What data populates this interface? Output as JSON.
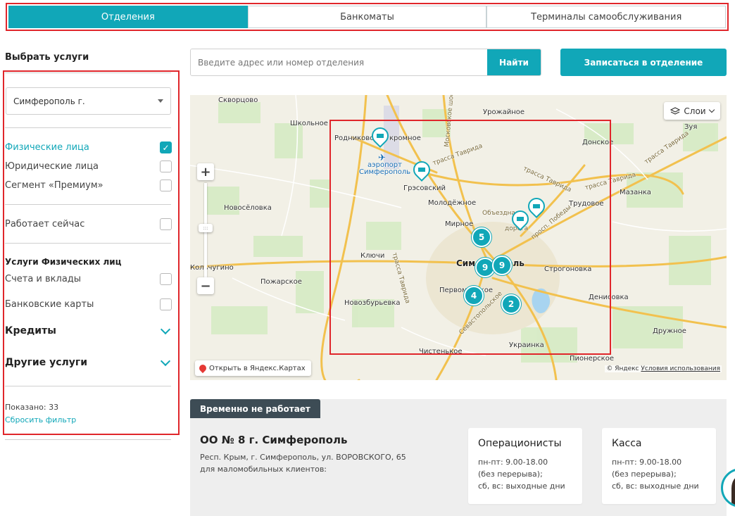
{
  "tabs": [
    {
      "label": "Отделения",
      "active": true
    },
    {
      "label": "Банкоматы",
      "active": false
    },
    {
      "label": "Терминалы самообслуживания",
      "active": false
    }
  ],
  "sidebar": {
    "title": "Выбрать услуги",
    "city": "Симферополь г.",
    "client_types": [
      {
        "label": "Физические лица",
        "checked": true
      },
      {
        "label": "Юридические лица",
        "checked": false
      },
      {
        "label": "Сегмент «Премиум»",
        "checked": false
      }
    ],
    "open_now": "Работает сейчас",
    "services_heading": "Услуги Физических лиц",
    "services": [
      {
        "label": "Счета и вклады",
        "checked": false
      },
      {
        "label": "Банковские карты",
        "checked": false
      }
    ],
    "credits": "Кредиты",
    "other_services": "Другие услуги",
    "shown": "Показано: 33",
    "reset": "Сбросить фильтр"
  },
  "search": {
    "placeholder": "Введите адрес или номер отделения",
    "value": "",
    "button": "Найти"
  },
  "book_button": "Записаться в отделение",
  "map": {
    "layers": "Слои",
    "open_yandex": "Открыть в Яндекс.Картах",
    "copyright": "© Яндекс",
    "terms": "Условия использования",
    "zoom_in": "+",
    "zoom_out": "−",
    "knob": ":::",
    "labels": {
      "skvortsovo": "Скворцово",
      "shkolnoe": "Школьное",
      "rodnikovo": "Родниково",
      "kromnoe": "кромное",
      "airport1": "аэропорт",
      "airport2": "Симферополь",
      "urozhainoe": "Урожайное",
      "donskoe": "Донское",
      "zuya": "Зуя",
      "gresovsky": "Грэсовский",
      "molodezhnoe": "Молодёжное",
      "trudovoe": "Трудовое",
      "mazanka": "Мазанка",
      "novoselovka": "Новосёловка",
      "mirnoe": "Мирное",
      "obezdnaya": "Объездная",
      "dubki": "дорога",
      "pobedy": "просп. Победы",
      "klyuchi": "Ключи",
      "simferopol": "Симферополь",
      "kolchugino": "Кольчугино",
      "pozharskoe": "Пожарское",
      "strogonovka": "Строгоновка",
      "pervomaiskoe": "Первомайское",
      "novozburyevka": "Новозбурьевка",
      "sevastopol": "Севастопольское",
      "denisovka": "Денисовка",
      "druzhnoe": "Дружное",
      "ukrainka": "Украинка",
      "chistenkoe": "Чистенькое",
      "pionerskoe": "Пионерское",
      "trassa_tavrida": "трасса Таврида",
      "trassa_tavrida2": "трасса Таврида",
      "trassa_tavrida3": "трасса Таврида",
      "trassa_tavrida4": "трасса Таврида",
      "trassa_tavrida5": "трасса Таврида",
      "moskovskoe": "Московское шоссе"
    },
    "clusters": [
      "5",
      "9",
      "9",
      "4",
      "2"
    ]
  },
  "office": {
    "status": "Временно не работает",
    "title": "ОО № 8 г. Симферополь",
    "address": "Респ. Крым, г. Симферополь, ул. ВОРОВСКОГО, 65",
    "note": "для маломобильных клиентов:",
    "hours": [
      {
        "title": "Операционисты",
        "lines": [
          "пн-пт: 9.00-18.00",
          "(без перерыва);",
          "сб, вс: выходные дни"
        ]
      },
      {
        "title": "Касса",
        "lines": [
          "пн-пт: 9.00-18.00",
          "(без перерыва);",
          "сб, вс: выходные дни"
        ]
      }
    ]
  },
  "colors": {
    "accent": "#11a7b8",
    "highlight": "#e0262b",
    "badge": "#3d4c55"
  }
}
